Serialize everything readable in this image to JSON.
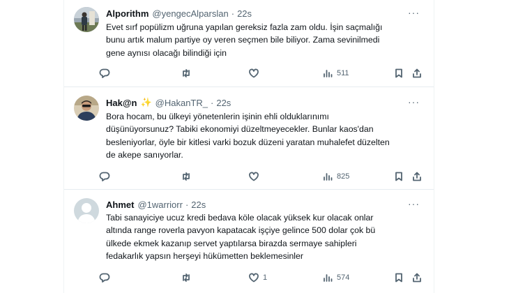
{
  "tweets": [
    {
      "name": "Alporithm",
      "handle": "@yengecAlparslan",
      "separator": "·",
      "time": "22s",
      "more": "···",
      "lines": [
        "Evet sırf popülizm uğruna yapılan gereksiz fazla zam oldu. İşin saçmalığı",
        "bunu artık malum partiye oy veren seçmen bile biliyor. Zama sevinilmedi",
        "gene aynısı olacağı bilindiği için"
      ],
      "replies": "",
      "retweets": "",
      "likes": "",
      "views": "511",
      "avatar": "avatar-person-standing"
    },
    {
      "name": "Hak@n",
      "emoji": "✨",
      "handle": "@HakanTR_",
      "separator": "·",
      "time": "22s",
      "more": "···",
      "lines": [
        "Bora hocam, bu ülkeyi yönetenlerin işinin ehli olduklarınımı",
        "düşünüyorsunuz? Tabiki ekonomiyi düzeltmeyecekler. Bunlar kaos'dan",
        "besleniyorlar, öyle bir kitlesi varki bozuk düzeni yaratan muhalefet düzelten",
        "de akepe sanıyorlar."
      ],
      "replies": "",
      "retweets": "",
      "likes": "",
      "views": "825",
      "avatar": "avatar-man-sunglasses"
    },
    {
      "name": "Ahmet",
      "handle": "@1warriorr",
      "separator": "·",
      "time": "22s",
      "more": "···",
      "lines": [
        "Tabi sanayiciye ucuz kredi bedava köle olacak yüksek kur olacak onlar",
        "altında range roverla pavyon kapatacak işçiye gelince 500 dolar çok bü",
        "ülkede ekmek kazanıp servet yaptılarsa birazda sermaye sahipleri",
        "fedakarlık yapsın herşeyi hükümetten beklemesinler"
      ],
      "replies": "",
      "retweets": "",
      "likes": "1",
      "views": "574",
      "avatar": "avatar-default-silhouette"
    }
  ],
  "colors": {
    "text": "#0f1419",
    "secondary": "#536471",
    "divider": "#eff3f4",
    "star": "#f5b300"
  }
}
